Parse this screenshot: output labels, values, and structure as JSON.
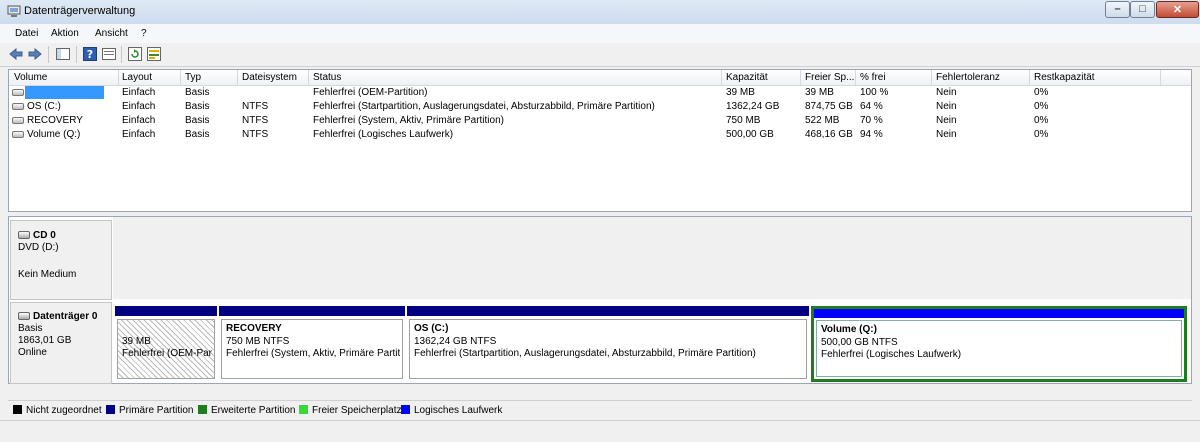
{
  "window": {
    "title": "Datenträgerverwaltung",
    "minimize_glyph": "–",
    "maximize_glyph": "□",
    "close_glyph": "✕"
  },
  "menu": [
    "Datei",
    "Aktion",
    "Ansicht",
    "?"
  ],
  "toolbar": {
    "icons": [
      "back-icon",
      "forward-icon",
      "properties-icon",
      "help-icon",
      "console-tree-icon",
      "refresh-icon",
      "settings-icon"
    ]
  },
  "volume_list": {
    "columns": [
      "Volume",
      "Layout",
      "Typ",
      "Dateisystem",
      "Status",
      "Kapazität",
      "Freier Sp...",
      "% frei",
      "Fehlertoleranz",
      "Restkapazität"
    ],
    "rows": [
      [
        "",
        "Einfach",
        "Basis",
        "",
        "Fehlerfrei (OEM-Partition)",
        "39 MB",
        "39 MB",
        "100 %",
        "Nein",
        "0%"
      ],
      [
        "OS (C:)",
        "Einfach",
        "Basis",
        "NTFS",
        "Fehlerfrei (Startpartition, Auslagerungsdatei, Absturzabbild, Primäre Partition)",
        "1362,24 GB",
        "874,75 GB",
        "64 %",
        "Nein",
        "0%"
      ],
      [
        "RECOVERY",
        "Einfach",
        "Basis",
        "NTFS",
        "Fehlerfrei (System, Aktiv, Primäre Partition)",
        "750 MB",
        "522 MB",
        "70 %",
        "Nein",
        "0%"
      ],
      [
        "Volume (Q:)",
        "Einfach",
        "Basis",
        "NTFS",
        "Fehlerfrei (Logisches Laufwerk)",
        "500,00 GB",
        "468,16 GB",
        "94 %",
        "Nein",
        "0%"
      ]
    ]
  },
  "cd": {
    "title": "CD 0",
    "drive": "DVD (D:)",
    "media": "Kein Medium"
  },
  "disk0": {
    "title": "Datenträger 0",
    "type": "Basis",
    "size": "1863,01 GB",
    "state": "Online"
  },
  "partitions": [
    {
      "title": "",
      "size": "39 MB",
      "status": "Fehlerfrei (OEM-Partition)"
    },
    {
      "title": "RECOVERY",
      "size": "750 MB NTFS",
      "status": "Fehlerfrei (System, Aktiv, Primäre Partition)"
    },
    {
      "title": "OS  (C:)",
      "size": "1362,24 GB NTFS",
      "status": "Fehlerfrei (Startpartition, Auslagerungsdatei, Absturzabbild, Primäre Partition)"
    },
    {
      "title": "Volume  (Q:)",
      "size": "500,00 GB NTFS",
      "status": "Fehlerfrei (Logisches Laufwerk)"
    }
  ],
  "legend": [
    {
      "label": "Nicht zugeordnet",
      "color": "#000000"
    },
    {
      "label": "Primäre Partition",
      "color": "#000080"
    },
    {
      "label": "Erweiterte Partition",
      "color": "#1e7d1e"
    },
    {
      "label": "Freier Speicherplatz",
      "color": "#33dd33"
    },
    {
      "label": "Logisches Laufwerk",
      "color": "#0000ff"
    }
  ]
}
